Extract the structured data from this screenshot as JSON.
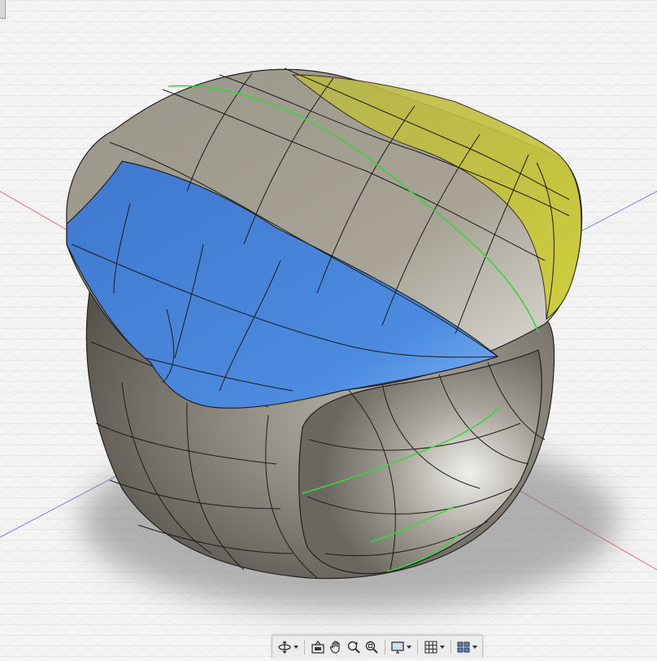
{
  "viewport": {
    "background": "#f4f4f4",
    "grid_color": "#dcdcdc",
    "axis_x_color": "#e07070",
    "axis_y_color": "#7a86d8",
    "body_color": "#8a857b",
    "selected_face_color": "#3f7fd6",
    "highlight_face_color": "#c4c43c",
    "edge_loop_color": "#3ad43a"
  },
  "toolbar": {
    "buttons": [
      {
        "name": "orbit-tool",
        "icon": "orbit-icon",
        "has_menu": true
      },
      {
        "name": "look-at",
        "icon": "look-at-icon",
        "has_menu": false
      },
      {
        "name": "pan-tool",
        "icon": "hand-icon",
        "has_menu": false
      },
      {
        "name": "zoom-tool",
        "icon": "zoom-icon",
        "has_menu": false
      },
      {
        "name": "fit-tool",
        "icon": "fit-icon",
        "has_menu": false
      },
      {
        "name": "display-settings",
        "icon": "display-icon",
        "has_menu": true
      },
      {
        "name": "grid-settings",
        "icon": "grid-icon",
        "has_menu": true
      },
      {
        "name": "viewports",
        "icon": "viewports-icon",
        "has_menu": true
      }
    ]
  }
}
